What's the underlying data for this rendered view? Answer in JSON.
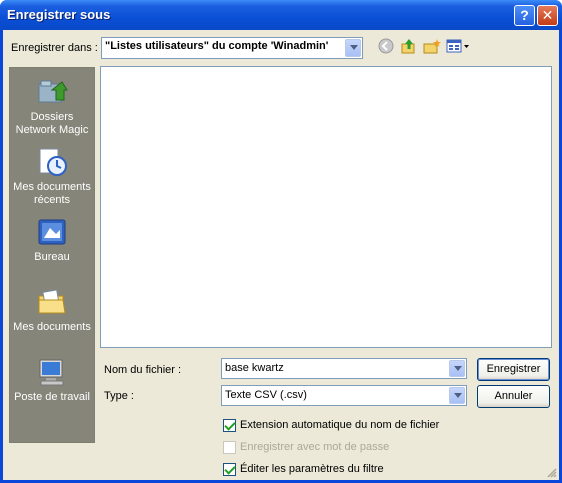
{
  "window": {
    "title": "Enregistrer sous",
    "help_glyph": "?",
    "close_glyph": "✕"
  },
  "toolbar": {
    "save_in_label": "Enregistrer dans :",
    "save_in_value": "\"Listes utilisateurs\" du compte 'Winadmin'",
    "icons": [
      "back-icon",
      "up-folder-icon",
      "new-folder-icon",
      "view-menu-icon"
    ]
  },
  "places": [
    {
      "label": "Dossiers Network Magic",
      "icon": "network-magic-folder-icon"
    },
    {
      "label": "Mes documents récents",
      "icon": "recent-documents-icon"
    },
    {
      "label": "Bureau",
      "icon": "desktop-icon"
    },
    {
      "label": "Mes documents",
      "icon": "my-documents-icon"
    },
    {
      "label": "Poste de travail",
      "icon": "my-computer-icon"
    }
  ],
  "form": {
    "filename_label": "Nom du fichier :",
    "filename_value": "base kwartz",
    "type_label": "Type :",
    "type_value": "Texte CSV (.csv)"
  },
  "buttons": {
    "save": "Enregistrer",
    "cancel": "Annuler"
  },
  "options": [
    {
      "label": "Extension automatique du nom de fichier",
      "checked": true,
      "enabled": true
    },
    {
      "label": "Enregistrer avec mot de passe",
      "checked": false,
      "enabled": false
    },
    {
      "label": "Éditer les paramètres du filtre",
      "checked": true,
      "enabled": true
    }
  ]
}
